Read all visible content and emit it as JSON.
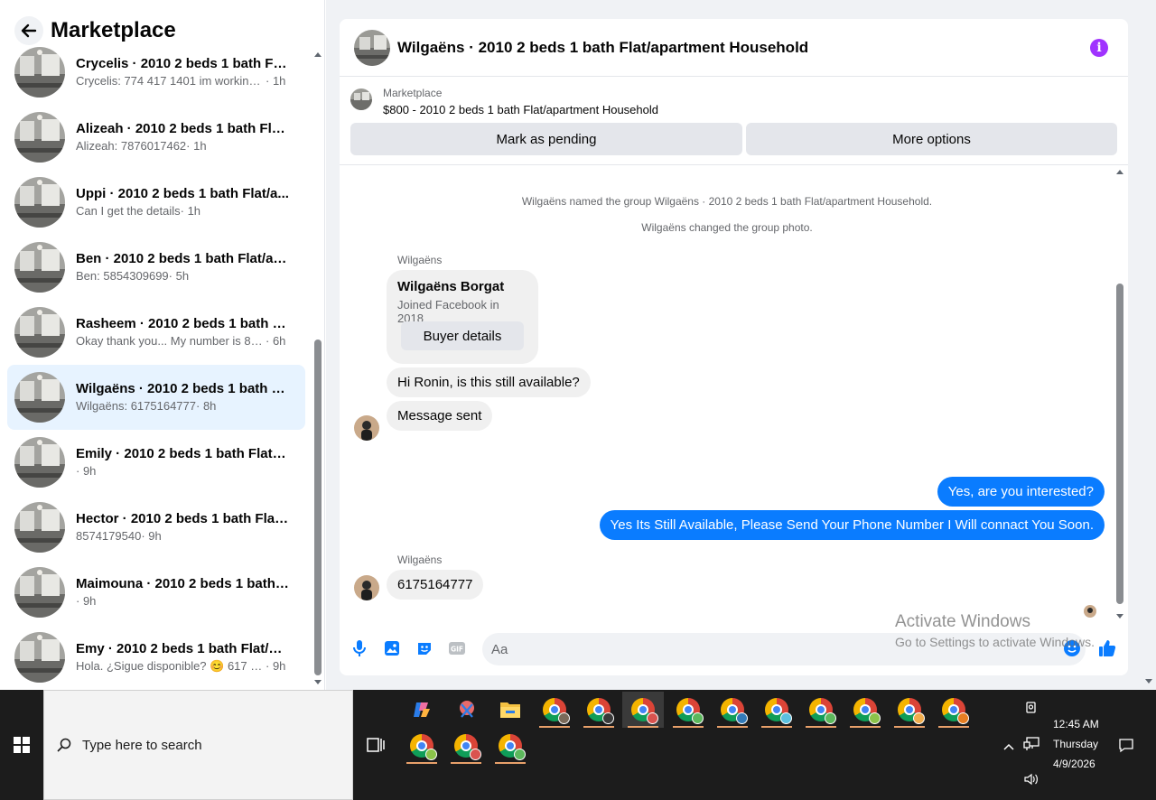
{
  "left": {
    "title": "Marketplace",
    "conversations": [
      {
        "name": "Crycelis · 2010 2 beds 1 bath Flat...",
        "snippet": "Crycelis: 774 417 1401 im working ...",
        "time": "· 1h"
      },
      {
        "name": "Alizeah · 2010 2 beds 1 bath Flat...",
        "snippet": "Alizeah: 7876017462",
        "time": " · 1h"
      },
      {
        "name": "Uppi · 2010 2 beds 1 bath Flat/a...",
        "snippet": "Can I get the details",
        "time": " · 1h"
      },
      {
        "name": "Ben · 2010 2 beds 1 bath Flat/ap...",
        "snippet": "Ben: 5854309699",
        "time": " · 5h"
      },
      {
        "name": "Rasheem · 2010 2 beds 1 bath Fl...",
        "snippet": "Okay thank you... My number is 85...",
        "time": " · 6h"
      },
      {
        "name": "Wilgaëns · 2010 2 beds 1 bath Fl...",
        "snippet": "Wilgaëns: 6175164777",
        "time": " · 8h"
      },
      {
        "name": "Emily · 2010 2 beds 1 bath Flat/a...",
        "snippet": "",
        "time": " · 9h"
      },
      {
        "name": "Hector · 2010 2 beds 1 bath Flat/...",
        "snippet": "8574179540",
        "time": " · 9h"
      },
      {
        "name": "Maimouna · 2010 2 beds 1 bath ...",
        "snippet": "",
        "time": " · 9h"
      },
      {
        "name": "Emy · 2010 2 beds 1 bath Flat/ap...",
        "snippet": "Hola. ¿Sigue disponible? 😊 617 51...",
        "time": " · 9h"
      }
    ]
  },
  "chat": {
    "title": "Wilgaëns · 2010 2 beds 1 bath Flat/apartment Household",
    "listing_label": "Marketplace",
    "listing_price": "$800 - 2010 2 beds 1 bath Flat/apartment Household",
    "mark_pending": "Mark as pending",
    "more_options": "More options",
    "sys1": "Wilgaëns named the group Wilgaëns · 2010 2 beds 1 bath Flat/apartment Household.",
    "sys2": "Wilgaëns changed the group photo.",
    "sender1": "Wilgaëns",
    "profile_name": "Wilgaëns Borgat",
    "profile_sub": "Joined Facebook in 2018",
    "buyer_details": "Buyer details",
    "msg_in1": "Hi Ronin, is this still available?",
    "msg_in2": "Message sent",
    "msg_out1": "Yes, are you interested?",
    "msg_out2": "Yes Its Still Available, Please Send Your Phone Number I Will connact You Soon.",
    "sender2": "Wilgaëns",
    "msg_in3": "6175164777",
    "composer_placeholder": "Aa"
  },
  "watermark": {
    "line1": "Activate Windows",
    "line2": "Go to Settings to activate Windows."
  },
  "taskbar": {
    "search_placeholder": "Type here to search",
    "time": "12:45 AM",
    "day": "Thursday",
    "date": "4/9/2026"
  },
  "colors": {
    "accent": "#0a7cff",
    "info": "#a033ff",
    "active_row": "#e7f3ff"
  }
}
